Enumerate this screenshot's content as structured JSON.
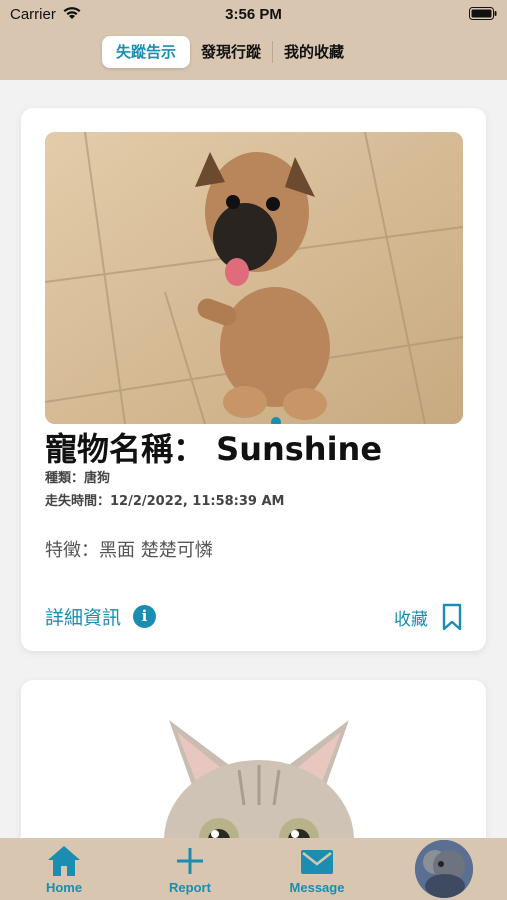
{
  "status_bar": {
    "carrier": "Carrier",
    "time": "3:56 PM"
  },
  "tabs_top": [
    {
      "label": "失蹤告示",
      "active": true
    },
    {
      "label": "發現行蹤",
      "active": false
    },
    {
      "label": "我的收藏",
      "active": false
    }
  ],
  "cards": [
    {
      "pet_name": "寵物名稱： Sunshine",
      "kind": "種類：唐狗",
      "lost_time": "走失時間：12/2/2022, 11:58:39 AM",
      "feature": "特徵：黑面 楚楚可憐",
      "detail_label": "詳細資訊",
      "favorite_label": "收藏",
      "photo": "brown-puppy-photo"
    },
    {
      "photo": "tabby-cat-photo"
    }
  ],
  "tab_bar": [
    {
      "label": "Home",
      "icon": "home-icon"
    },
    {
      "label": "Report",
      "icon": "plus-icon"
    },
    {
      "label": "Message",
      "icon": "mail-icon"
    },
    {
      "label": "",
      "icon": "profile-avatar"
    }
  ],
  "colors": {
    "accent": "#1a8db0",
    "bar": "#d8c6b0",
    "background": "#f2f2f2"
  }
}
